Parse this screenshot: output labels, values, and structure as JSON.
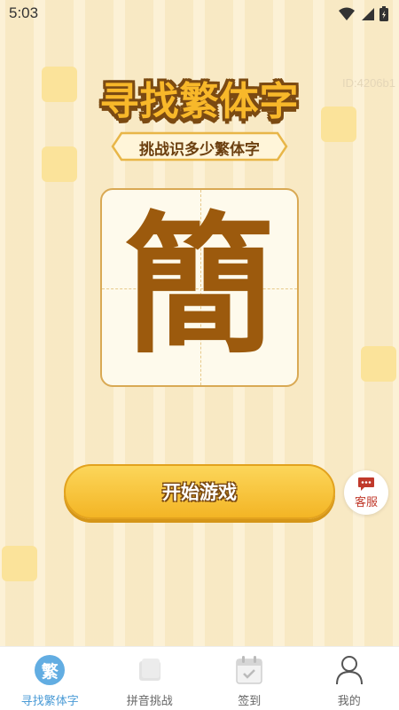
{
  "status_bar": {
    "time": "5:03"
  },
  "header": {
    "title": "寻找繁体字",
    "subtitle": "挑战识多少繁体字",
    "id_text": "ID:4206b1"
  },
  "card": {
    "character": "簡"
  },
  "actions": {
    "start_label": "开始游戏",
    "service_label": "客服"
  },
  "tabbar": {
    "items": [
      {
        "label": "寻找繁体字",
        "icon": "fan-char-icon",
        "icon_text": "繁",
        "active": true
      },
      {
        "label": "拼音挑战",
        "icon": "book-icon",
        "active": false
      },
      {
        "label": "签到",
        "icon": "calendar-check-icon",
        "active": false
      },
      {
        "label": "我的",
        "icon": "user-icon",
        "active": false
      }
    ]
  },
  "colors": {
    "background": "#fcf1d7",
    "accent_yellow": "#f8b82a",
    "text_brown": "#7b4a12",
    "active_tab": "#4a9bd6",
    "service_red": "#c0392b"
  }
}
